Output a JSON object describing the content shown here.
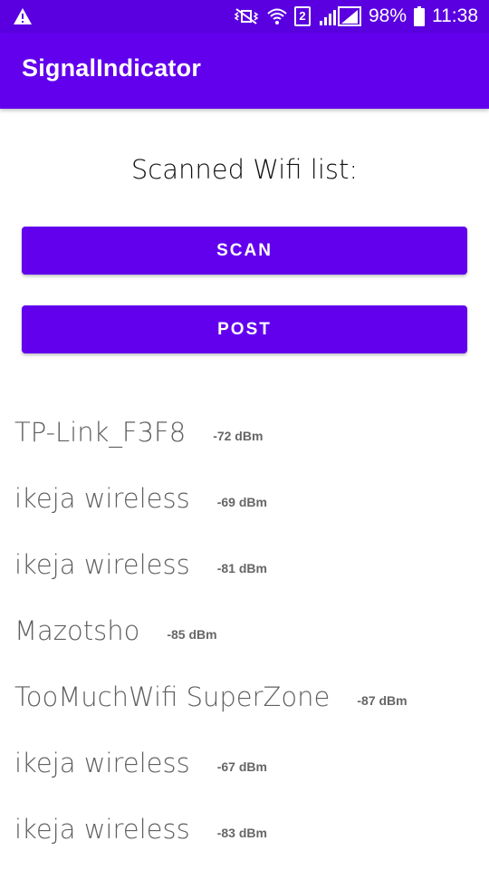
{
  "status_bar": {
    "battery": "98%",
    "time": "11:38",
    "sim_slot": "2",
    "icons": [
      "warning-icon",
      "mute-vibrate-icon",
      "wifi-icon",
      "signal-icon",
      "battery-icon"
    ]
  },
  "app_bar": {
    "title": "SignalIndicator",
    "color": "#6200ee"
  },
  "main": {
    "heading": "Scanned Wifi list:",
    "scan_label": "SCAN",
    "post_label": "POST"
  },
  "wifi_list": [
    {
      "ssid": "TP-Link_F3F8",
      "level": "-72 dBm"
    },
    {
      "ssid": "ikeja wireless",
      "level": "-69 dBm"
    },
    {
      "ssid": "ikeja wireless",
      "level": "-81 dBm"
    },
    {
      "ssid": "Mazotsho",
      "level": "-85 dBm"
    },
    {
      "ssid": "TooMuchWifi SuperZone",
      "level": "-87 dBm"
    },
    {
      "ssid": "ikeja wireless",
      "level": "-67 dBm"
    },
    {
      "ssid": "ikeja wireless",
      "level": "-83 dBm"
    }
  ]
}
